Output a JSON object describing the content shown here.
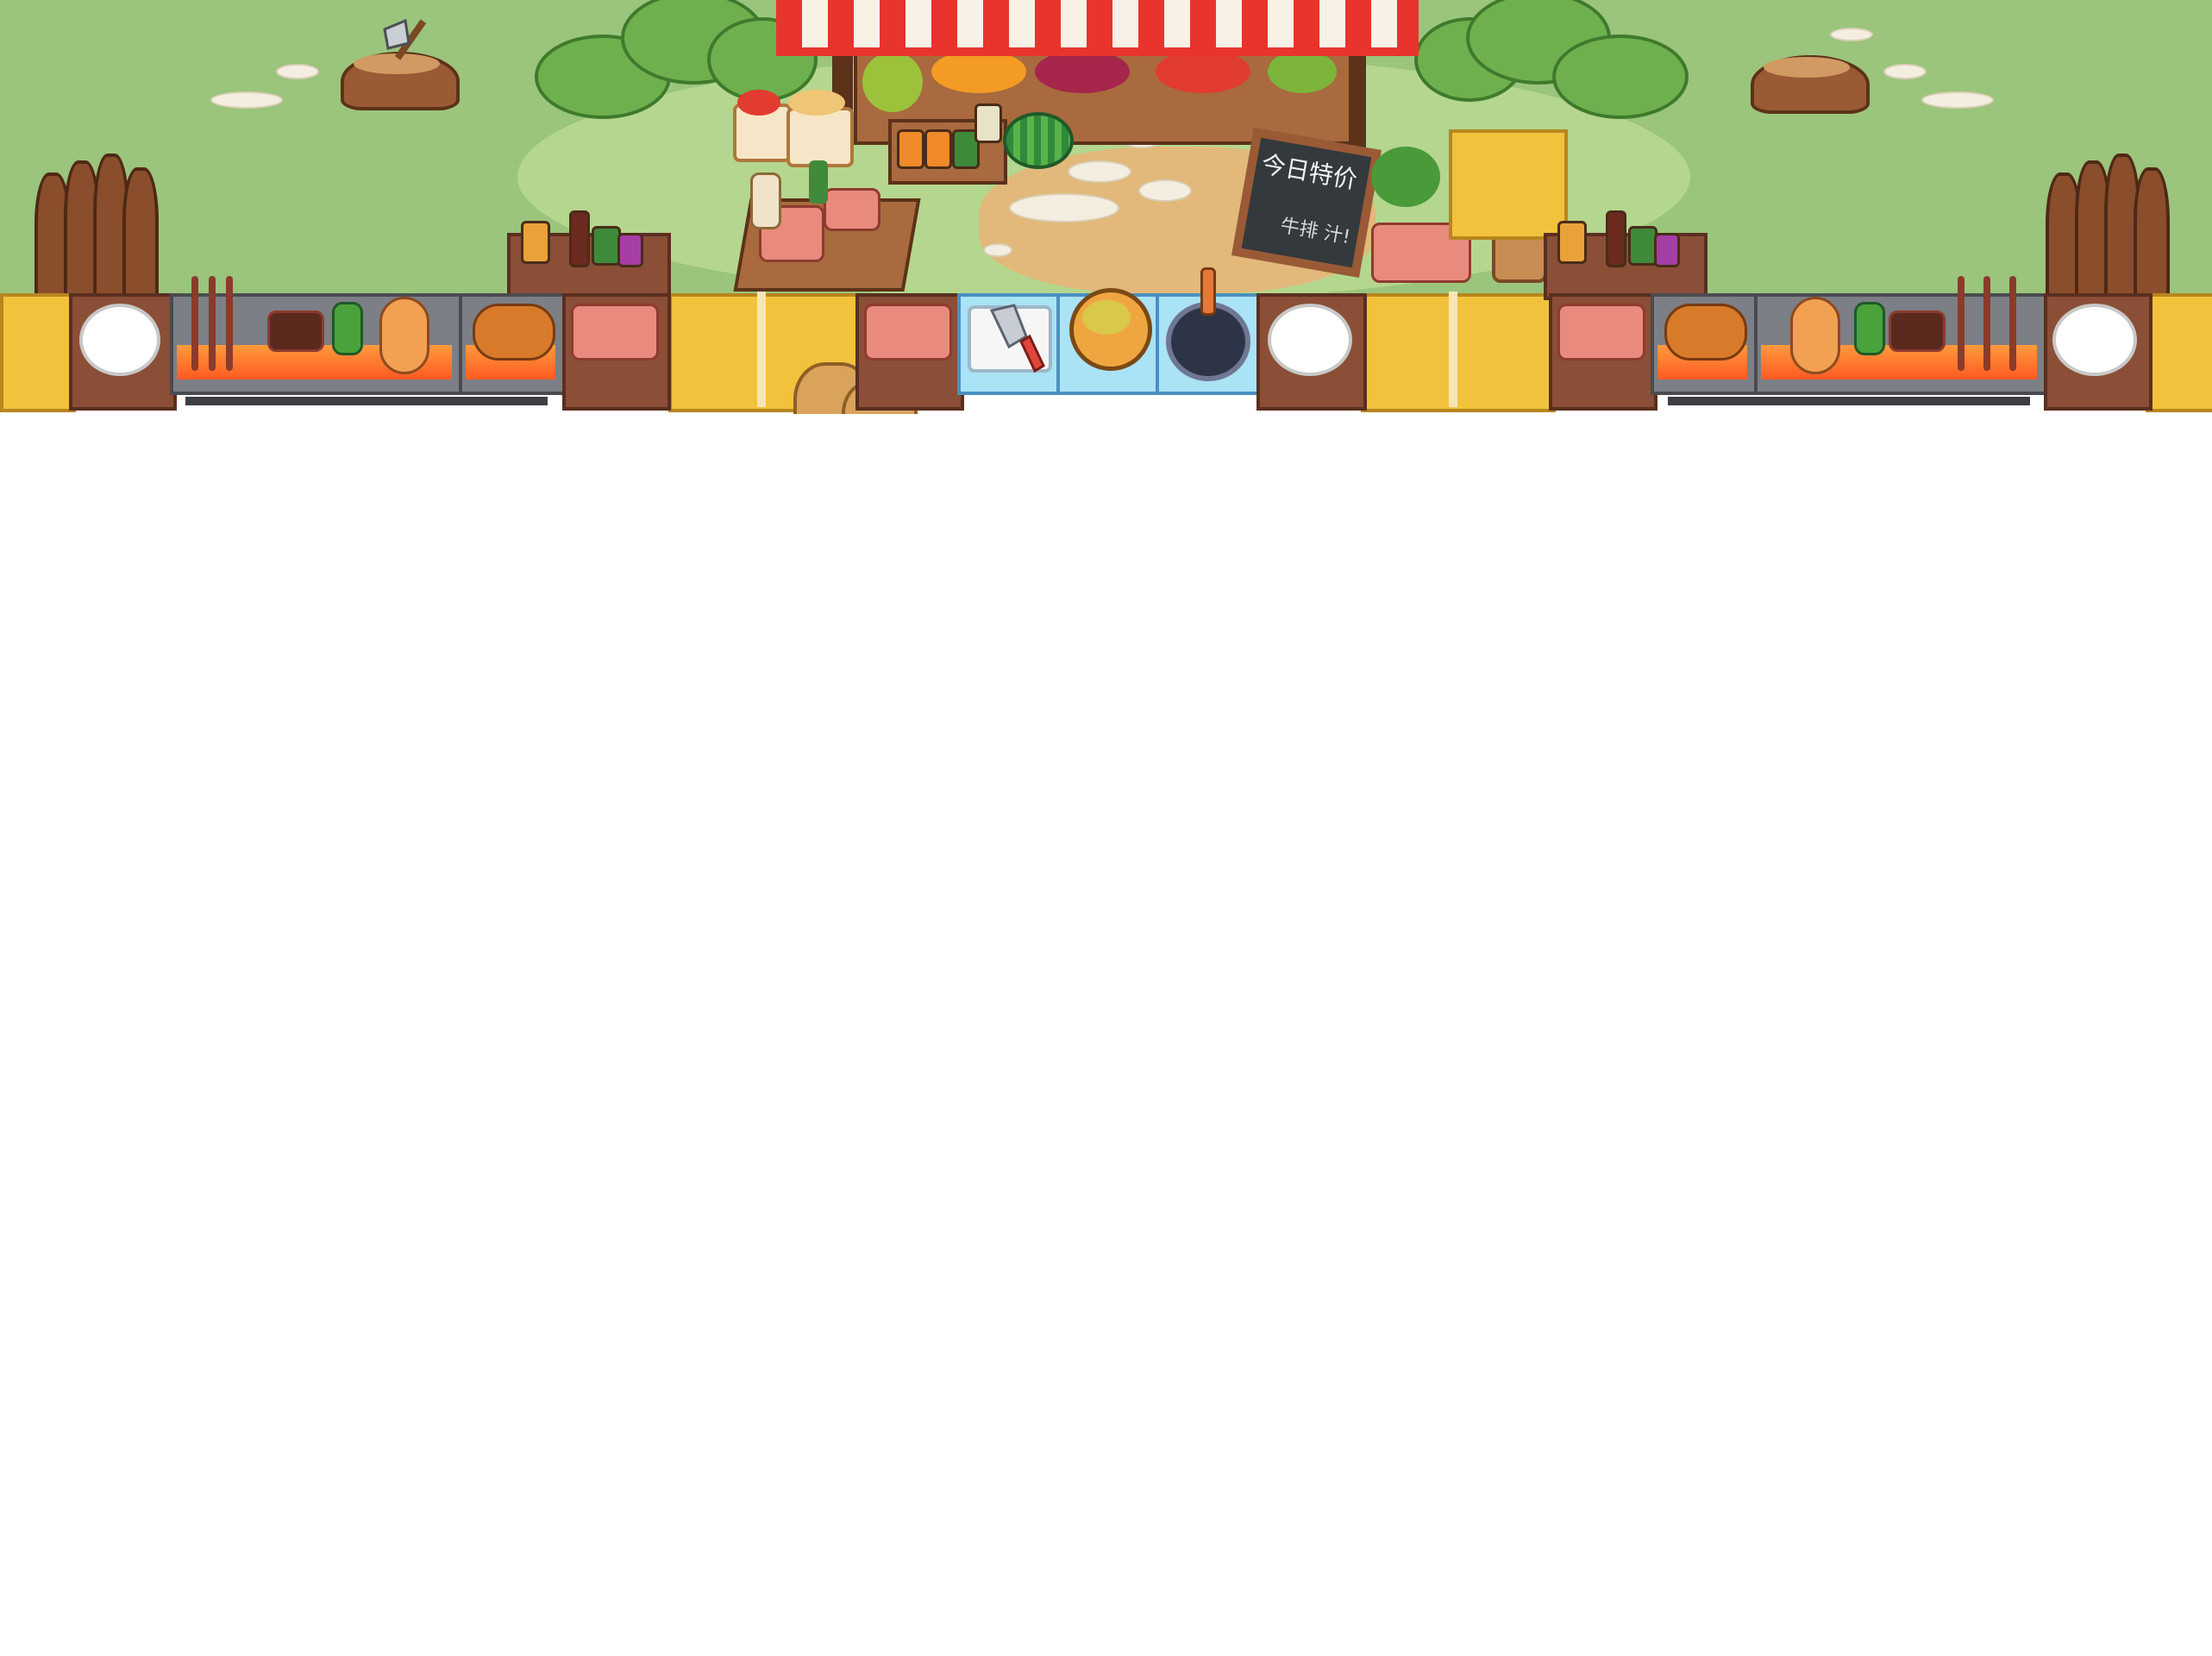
{
  "scene": {
    "name": "market-bbq-kitchen-level",
    "colors": {
      "grass": "#9bc47c",
      "dirt": "#e2b97a",
      "awning_red": "#e8342c",
      "hay": "#f2c23d",
      "counter": "#8a4f36",
      "grill_metal": "#7c7f86",
      "prep_counter": "#a9e3f5",
      "background": "#ffffff"
    }
  },
  "signboard": {
    "title": "今日特价",
    "subtitle": "牛排 汁!"
  },
  "stations": {
    "left_grill": [
      "skewers",
      "steak",
      "pepper",
      "eggplant",
      "roast-chicken"
    ],
    "center_prep": [
      "cutting-board",
      "soup-pot",
      "frying-pan"
    ],
    "right_grill": [
      "roast-chicken",
      "eggplant",
      "pepper",
      "steak",
      "skewers"
    ]
  },
  "icons": {
    "axe": "axe-icon",
    "knife": "knife-icon",
    "pot": "soup-pot-icon",
    "pan": "frying-pan-icon"
  }
}
